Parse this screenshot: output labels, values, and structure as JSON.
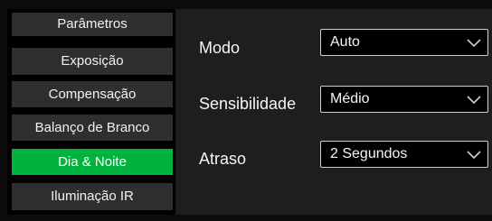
{
  "sidebar": {
    "items": [
      {
        "label": "Parâmetros",
        "active": false
      },
      {
        "label": "Exposição",
        "active": false
      },
      {
        "label": "Compensação",
        "active": false
      },
      {
        "label": "Balanço de Branco",
        "active": false
      },
      {
        "label": "Dia & Noite",
        "active": true
      },
      {
        "label": "Iluminação IR",
        "active": false
      }
    ]
  },
  "settings": {
    "mode": {
      "label": "Modo",
      "value": "Auto"
    },
    "sensitivity": {
      "label": "Sensibilidade",
      "value": "Médio"
    },
    "delay": {
      "label": "Atraso",
      "value": "2 Segundos"
    }
  },
  "colors": {
    "accent": "#00b33c",
    "nav_bg": "#2f2f2f",
    "panel_bg": "#1e1e1e"
  },
  "icons": {
    "dropdown": "chevron-down-icon"
  }
}
